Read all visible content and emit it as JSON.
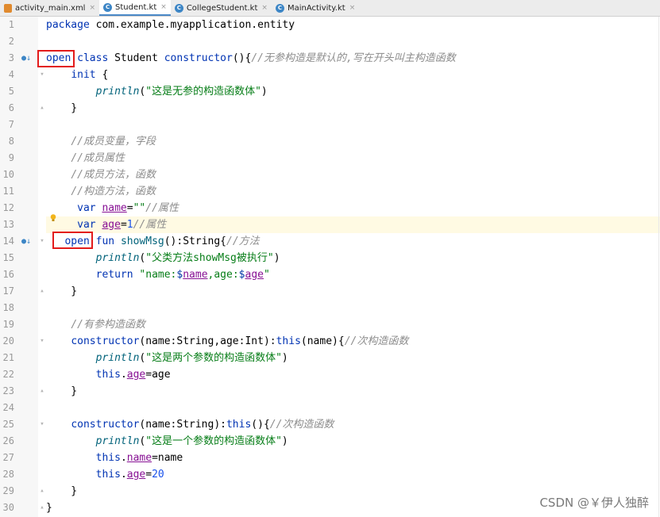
{
  "tabs": [
    {
      "label": "activity_main.xml",
      "icon": "xml-file-icon",
      "active": false
    },
    {
      "label": "Student.kt",
      "icon": "kotlin-class-icon",
      "active": true
    },
    {
      "label": "CollegeStudent.kt",
      "icon": "kotlin-class-icon",
      "active": false
    },
    {
      "label": "MainActivity.kt",
      "icon": "kotlin-class-icon",
      "active": false
    }
  ],
  "tab_close_glyph": "×",
  "line_numbers": [
    "1",
    "2",
    "3",
    "4",
    "5",
    "6",
    "7",
    "8",
    "9",
    "10",
    "11",
    "12",
    "13",
    "14",
    "15",
    "16",
    "17",
    "18",
    "19",
    "20",
    "21",
    "22",
    "23",
    "24",
    "25",
    "26",
    "27",
    "28",
    "29",
    "30"
  ],
  "code": {
    "l1": {
      "kw": "package",
      "rest": " com.example.myapplication.entity"
    },
    "l3": {
      "open": "open",
      "kw": " class",
      "name": " Student ",
      "kw2": "constructor",
      "punct": "(){",
      "cmt": "//无参构造是默认的,写在开头叫主构造函数"
    },
    "l4": {
      "indent": "    ",
      "kw": "init",
      "rest": " {"
    },
    "l5": {
      "indent": "        ",
      "fn": "println",
      "p1": "(",
      "str": "\"这是无参的构造函数体\"",
      "p2": ")"
    },
    "l6": {
      "text": "    }"
    },
    "l8": {
      "indent": "    ",
      "cmt": "//成员变量，字段"
    },
    "l9": {
      "indent": "    ",
      "cmt": "//成员属性"
    },
    "l10": {
      "indent": "    ",
      "cmt": "//成员方法，函数"
    },
    "l11": {
      "indent": "    ",
      "cmt": "//构造方法，函数"
    },
    "l12": {
      "indent": "     ",
      "kw": "var",
      "sp": " ",
      "prop": "name",
      "eq": "=",
      "str": "\"\"",
      "cmt": "//属性"
    },
    "l13": {
      "indent": "     ",
      "kw": "var",
      "sp": " ",
      "prop": "age",
      "eq": "=",
      "num": "1",
      "cmt": "//属性"
    },
    "l14": {
      "indent": "   ",
      "open": "open",
      "kw": " fun",
      "sp": " ",
      "fn": "showMsg",
      "rest": "():String{",
      "cmt": "//方法"
    },
    "l15": {
      "indent": "        ",
      "fn": "println",
      "p1": "(",
      "str": "\"父类方法showMsg被执行\"",
      "p2": ")"
    },
    "l16": {
      "indent": "        ",
      "kw": "return",
      "sp": " ",
      "s1": "\"name:",
      "t1": "$",
      "v1": "name",
      "s2": ",age:",
      "t2": "$",
      "v2": "age",
      "s3": "\""
    },
    "l17": {
      "text": "    }"
    },
    "l19": {
      "indent": "    ",
      "cmt": "//有参构造函数"
    },
    "l20": {
      "indent": "    ",
      "kw": "constructor",
      "rest": "(name:String,age:Int):",
      "kw2": "this",
      "rest2": "(name){",
      "cmt": "//次构造函数"
    },
    "l21": {
      "indent": "        ",
      "fn": "println",
      "p1": "(",
      "str": "\"这是两个参数的构造函数体\"",
      "p2": ")"
    },
    "l22": {
      "indent": "        ",
      "kw": "this",
      "dot": ".",
      "prop": "age",
      "rest": "=age"
    },
    "l23": {
      "text": "    }"
    },
    "l25": {
      "indent": "    ",
      "kw": "constructor",
      "rest": "(name:String):",
      "kw2": "this",
      "rest2": "(){",
      "cmt": "//次构造函数"
    },
    "l26": {
      "indent": "        ",
      "fn": "println",
      "p1": "(",
      "str": "\"这是一个参数的构造函数体\"",
      "p2": ")"
    },
    "l27": {
      "indent": "        ",
      "kw": "this",
      "dot": ".",
      "prop": "name",
      "rest": "=name"
    },
    "l28": {
      "indent": "        ",
      "kw": "this",
      "dot": ".",
      "prop": "age",
      "eq": "=",
      "num": "20"
    },
    "l29": {
      "text": "    }"
    },
    "l30": {
      "text": "}"
    }
  },
  "watermark": "CSDN @￥伊人独醉",
  "colors": {
    "keyword": "#0033b3",
    "string": "#067d17",
    "number": "#1750eb",
    "comment": "#8c8c8c",
    "function": "#00627a",
    "property": "#871094",
    "highlight_box": "#e31b1b",
    "current_line": "#fffae3"
  },
  "icons": {
    "override_marker": "override-marker-icon",
    "intention_bulb": "lightbulb-icon",
    "fold": "fold-arrow-icon"
  }
}
